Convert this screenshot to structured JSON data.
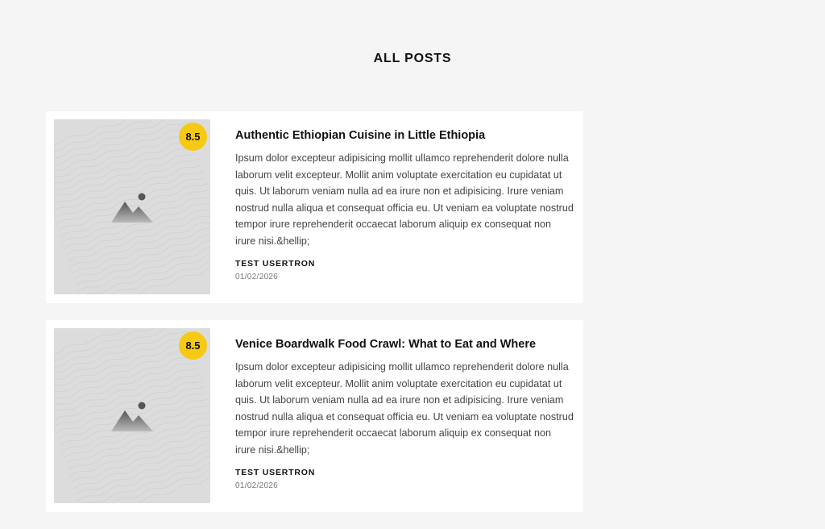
{
  "page": {
    "title": "ALL POSTS"
  },
  "colors": {
    "background": "#f5f5f5",
    "card": "#ffffff",
    "rating_badge": "#f6c915",
    "thumbnail": "#dcdcdc"
  },
  "posts": [
    {
      "rating": "8.5",
      "title": "Authentic Ethiopian Cuisine in Little Ethiopia",
      "excerpt": "Ipsum dolor excepteur adipisicing mollit ullamco reprehenderit dolore nulla laborum velit excepteur. Mollit anim voluptate exercitation eu cupidatat ut quis. Ut laborum veniam nulla ad ea irure non et adipisicing. Irure veniam nostrud nulla aliqua et consequat officia eu. Ut veniam ea voluptate nostrud tempor irure reprehenderit occaecat laborum aliquip ex consequat non irure nisi.&hellip;",
      "author": "TEST USERTRON",
      "date": "01/02/2026",
      "thumbnail_icon": "image-placeholder-icon"
    },
    {
      "rating": "8.5",
      "title": "Venice Boardwalk Food Crawl: What to Eat and Where",
      "excerpt": "Ipsum dolor excepteur adipisicing mollit ullamco reprehenderit dolore nulla laborum velit excepteur. Mollit anim voluptate exercitation eu cupidatat ut quis. Ut laborum veniam nulla ad ea irure non et adipisicing. Irure veniam nostrud nulla aliqua et consequat officia eu. Ut veniam ea voluptate nostrud tempor irure reprehenderit occaecat laborum aliquip ex consequat non irure nisi.&hellip;",
      "author": "TEST USERTRON",
      "date": "01/02/2026",
      "thumbnail_icon": "image-placeholder-icon"
    }
  ]
}
